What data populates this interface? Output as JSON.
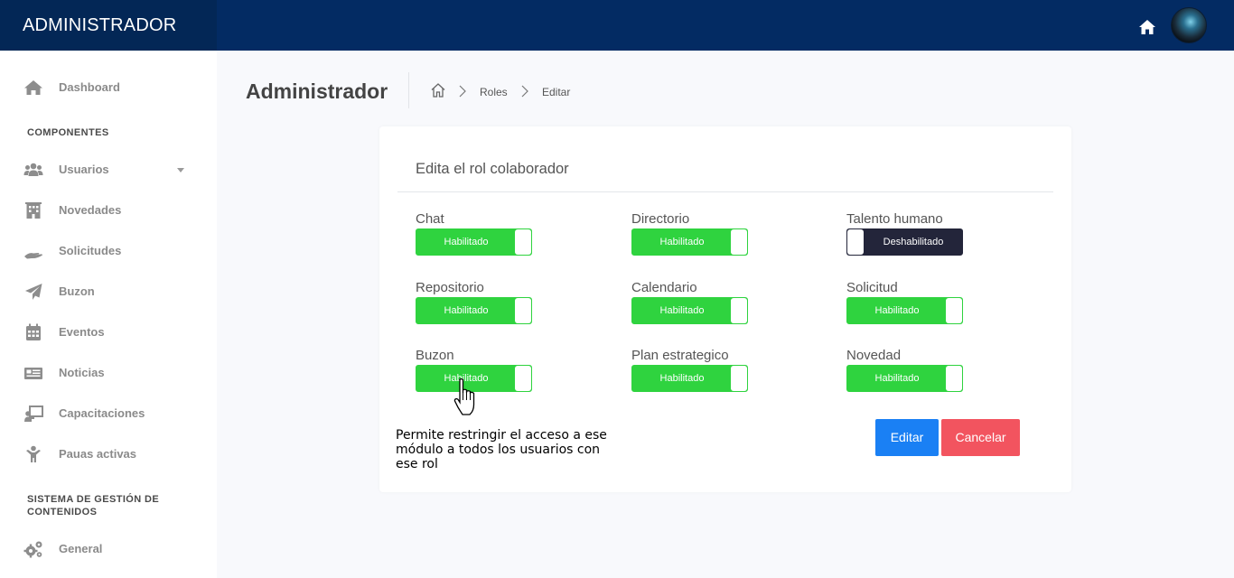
{
  "header": {
    "brand": "ADMINISTRADOR",
    "home_icon": "home-icon",
    "avatar": "user-avatar",
    "bg_color": "#032b63"
  },
  "sidebar": {
    "dashboard": {
      "label": "Dashboard",
      "icon": "home-icon"
    },
    "section_components": "COMPONENTES",
    "items": [
      {
        "label": "Usuarios",
        "icon": "users-icon",
        "has_caret": true
      },
      {
        "label": "Novedades",
        "icon": "building-icon"
      },
      {
        "label": "Solicitudes",
        "icon": "hand-icon"
      },
      {
        "label": "Buzon",
        "icon": "paper-plane-icon"
      },
      {
        "label": "Eventos",
        "icon": "calendar-icon"
      },
      {
        "label": "Noticias",
        "icon": "newspaper-icon"
      },
      {
        "label": "Capacitaciones",
        "icon": "teacher-icon"
      },
      {
        "label": "Pauas activas",
        "icon": "child-icon"
      }
    ],
    "section_cms": "SISTEMA DE GESTIÓN DE CONTENIDOS",
    "general": {
      "label": "General",
      "icon": "gears-icon"
    }
  },
  "main": {
    "page_title": "Administrador",
    "breadcrumb": [
      "Roles",
      "Editar"
    ]
  },
  "card": {
    "title": "Edita el rol colaborador",
    "permissions": [
      {
        "label": "Chat",
        "state": "Habilitado",
        "enabled": true
      },
      {
        "label": "Directorio",
        "state": "Habilitado",
        "enabled": true
      },
      {
        "label": "Talento humano",
        "state": "Deshabilitado",
        "enabled": false
      },
      {
        "label": "Repositorio",
        "state": "Habilitado",
        "enabled": true
      },
      {
        "label": "Calendario",
        "state": "Habilitado",
        "enabled": true
      },
      {
        "label": "Solicitud",
        "state": "Habilitado",
        "enabled": true
      },
      {
        "label": "Buzon",
        "state": "Habilitado",
        "enabled": true
      },
      {
        "label": "Plan estrategico",
        "state": "Habilitado",
        "enabled": true
      },
      {
        "label": "Novedad",
        "state": "Habilitado",
        "enabled": true
      }
    ],
    "edit_label": "Editar",
    "cancel_label": "Cancelar"
  },
  "tooltip": "Permite restringir el acceso a ese módulo a todos los usuarios con ese rol",
  "colors": {
    "enabled": "#2fd33f",
    "disabled": "#23253a",
    "edit": "#1a80f4",
    "cancel": "#f2545f"
  }
}
